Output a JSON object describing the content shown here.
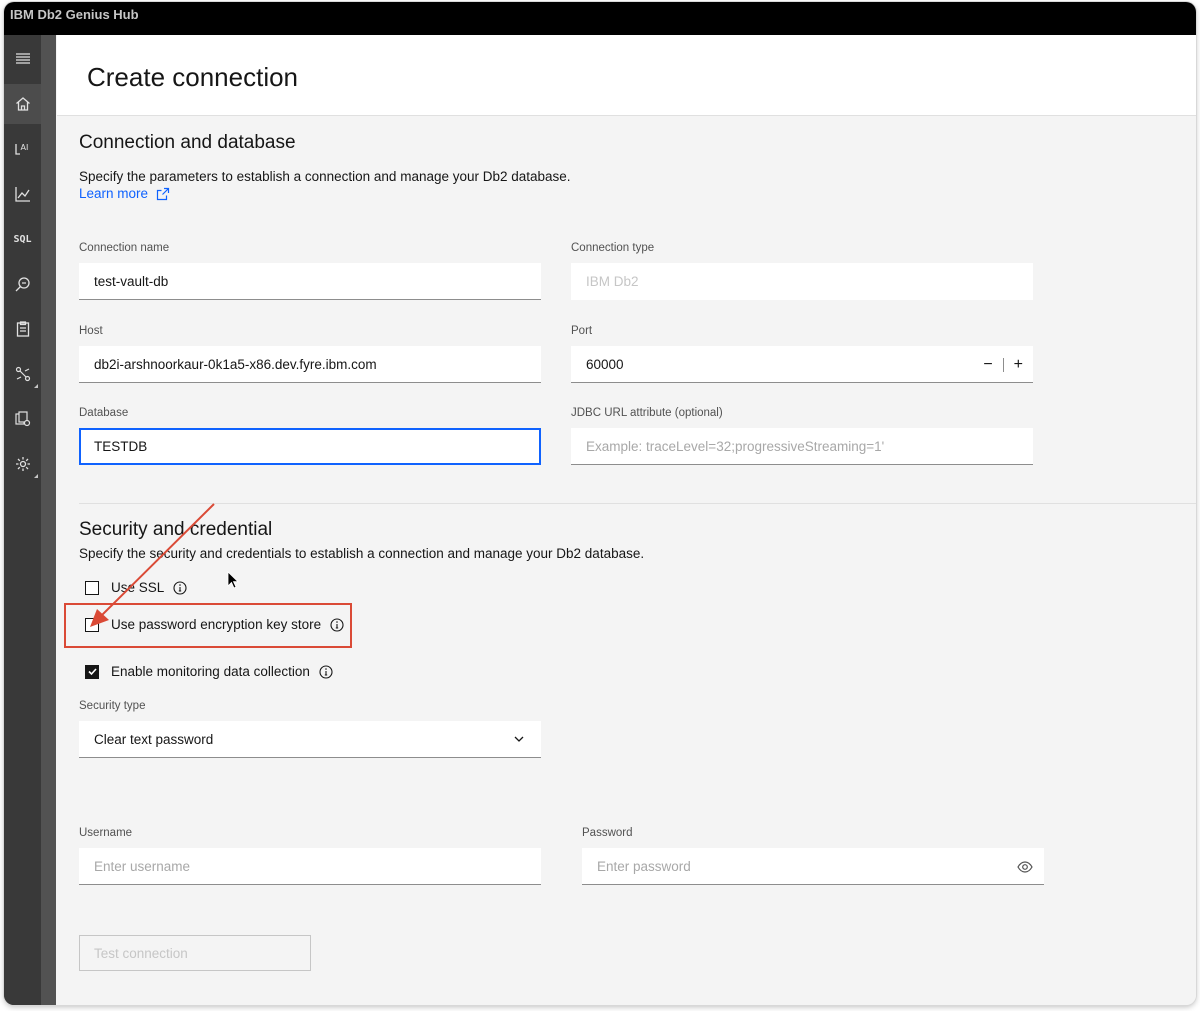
{
  "app": {
    "title": "IBM Db2 Genius Hub"
  },
  "sidebar": {
    "items": [
      {
        "name": "menu",
        "icon": "hamburger-menu-icon"
      },
      {
        "name": "home",
        "icon": "home-icon"
      },
      {
        "name": "ai",
        "icon": "ai-icon"
      },
      {
        "name": "monitor",
        "icon": "chart-icon"
      },
      {
        "name": "sql",
        "icon": "sql-icon",
        "label": "SQL"
      },
      {
        "name": "query",
        "icon": "search-analyze-icon"
      },
      {
        "name": "reports",
        "icon": "clipboard-icon"
      },
      {
        "name": "tools",
        "icon": "tools-icon"
      },
      {
        "name": "manage",
        "icon": "manage-icon"
      },
      {
        "name": "settings",
        "icon": "gear-icon"
      }
    ]
  },
  "header": {
    "title": "Create connection"
  },
  "connection_section": {
    "title": "Connection and database",
    "description": "Specify the parameters to establish a connection and manage your Db2 database.",
    "learn_more": "Learn more",
    "fields": {
      "connection_name": {
        "label": "Connection name",
        "value": "test-vault-db"
      },
      "connection_type": {
        "label": "Connection type",
        "value": "IBM Db2"
      },
      "host": {
        "label": "Host",
        "value": "db2i-arshnoorkaur-0k1a5-x86.dev.fyre.ibm.com"
      },
      "port": {
        "label": "Port",
        "value": "60000",
        "decrement": "−",
        "increment": "+"
      },
      "database": {
        "label": "Database",
        "value": "TESTDB"
      },
      "jdbc": {
        "label": "JDBC URL attribute (optional)",
        "placeholder": "Example: traceLevel=32;progressiveStreaming=1'"
      }
    }
  },
  "security_section": {
    "title": "Security and credential",
    "description": "Specify the security and credentials to establish a connection and manage your Db2 database.",
    "checkboxes": {
      "use_ssl": {
        "label": "Use SSL",
        "checked": false
      },
      "key_store": {
        "label": "Use password encryption key store",
        "checked": false
      },
      "monitoring": {
        "label": "Enable monitoring data collection",
        "checked": true
      }
    },
    "security_type": {
      "label": "Security type",
      "value": "Clear text password"
    },
    "username": {
      "label": "Username",
      "placeholder": "Enter username"
    },
    "password": {
      "label": "Password",
      "placeholder": "Enter password"
    }
  },
  "actions": {
    "test_connection": "Test connection"
  },
  "colors": {
    "accent": "#0f62fe",
    "highlight": "#da4a36",
    "topbar": "#000000",
    "sidebar": "#393939",
    "background": "#f4f4f4"
  }
}
